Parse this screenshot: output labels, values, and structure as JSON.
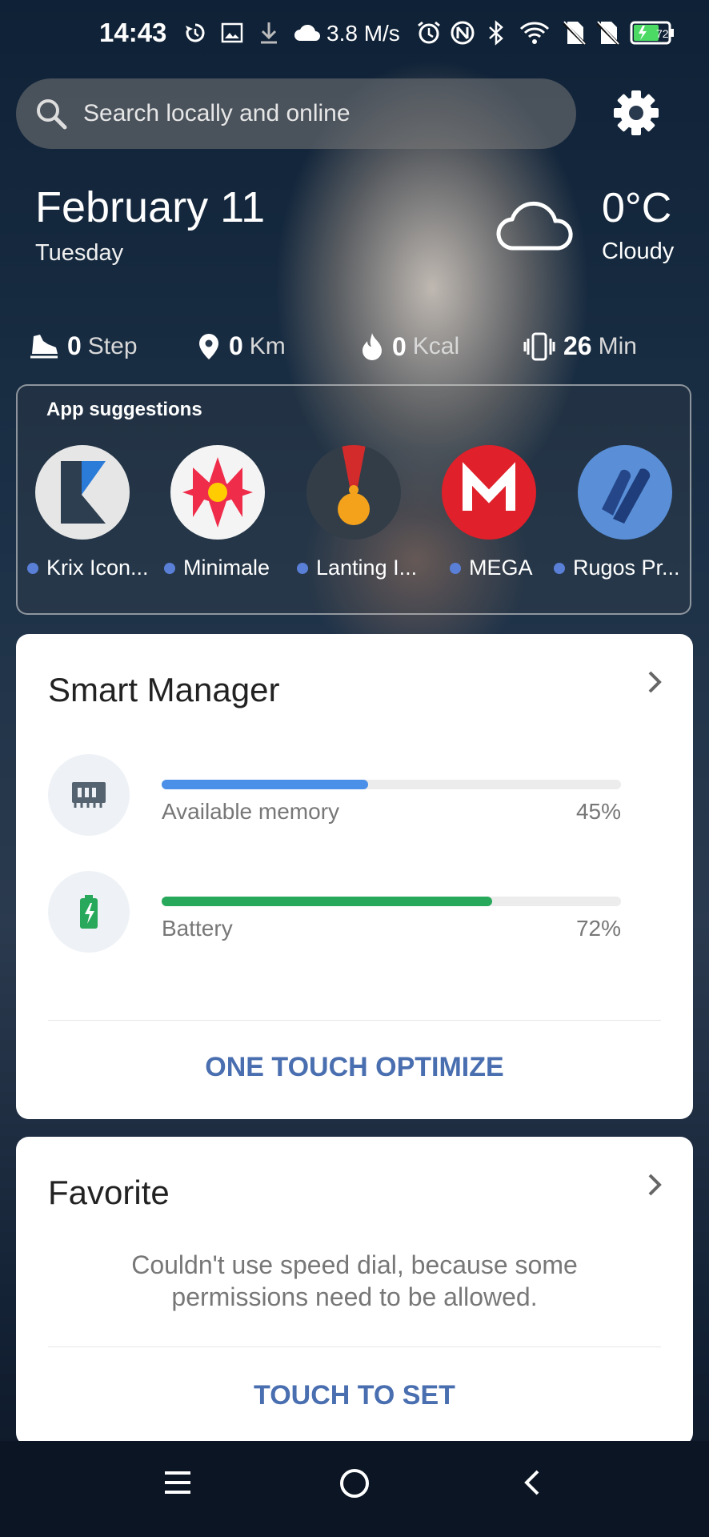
{
  "status_bar": {
    "time": "14:43",
    "net_speed": "3.8 M/s",
    "battery_level": "72",
    "icons": [
      "sync-icon",
      "image-icon",
      "download-icon",
      "cloud-icon",
      "alarm-icon",
      "nfc-icon",
      "bluetooth-icon",
      "wifi-icon",
      "no-sim-icon",
      "no-sim-icon",
      "battery-icon"
    ]
  },
  "search": {
    "placeholder": "Search locally and online"
  },
  "date": {
    "date": "February 11",
    "weekday": "Tuesday"
  },
  "weather": {
    "temp": "0°C",
    "condition": "Cloudy"
  },
  "stats": [
    {
      "value": "0",
      "unit": "Step",
      "icon": "shoe-icon"
    },
    {
      "value": "0",
      "unit": "Km",
      "icon": "location-pin-icon"
    },
    {
      "value": "0",
      "unit": "Kcal",
      "icon": "flame-icon"
    },
    {
      "value": "26",
      "unit": "Min",
      "icon": "phone-vibrate-icon"
    }
  ],
  "app_suggestions": {
    "title": "App suggestions",
    "apps": [
      {
        "label": "Krix Icon..."
      },
      {
        "label": "Minimale"
      },
      {
        "label": "Lanting I..."
      },
      {
        "label": "MEGA"
      },
      {
        "label": "Rugos Pr..."
      }
    ]
  },
  "smart_manager": {
    "title": "Smart Manager",
    "memory": {
      "label": "Available memory",
      "percent_text": "45%",
      "fraction": 0.45,
      "color": "#4a8fe8"
    },
    "battery": {
      "label": "Battery",
      "percent_text": "72%",
      "fraction": 0.72,
      "color": "#27a85a"
    },
    "action": "ONE TOUCH OPTIMIZE"
  },
  "favorite": {
    "title": "Favorite",
    "message": "Couldn't use speed dial, because some permissions need to be allowed.",
    "action": "TOUCH TO SET"
  },
  "colors": {
    "accent": "#4a6fb0",
    "memory": "#4a8fe8",
    "battery": "#27a85a"
  }
}
